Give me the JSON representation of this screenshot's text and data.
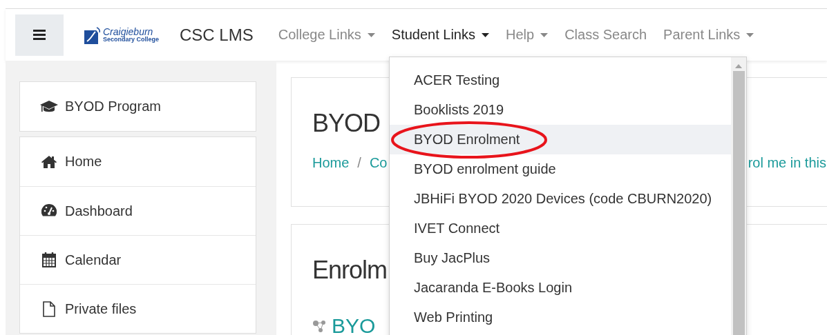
{
  "navbar": {
    "logo": {
      "name": "Craigieburn",
      "subtitle": "Secondary College"
    },
    "site_name": "CSC LMS",
    "links": [
      {
        "label": "College Links",
        "has_dropdown": true,
        "selected": false
      },
      {
        "label": "Student Links",
        "has_dropdown": true,
        "selected": true
      },
      {
        "label": "Help",
        "has_dropdown": true,
        "selected": false
      },
      {
        "label": "Class Search",
        "has_dropdown": false,
        "selected": false
      },
      {
        "label": "Parent Links",
        "has_dropdown": true,
        "selected": false
      }
    ]
  },
  "sidebar": {
    "groups": [
      [
        {
          "label": "BYOD Program",
          "kind": "course"
        }
      ],
      [
        {
          "label": "Home",
          "kind": "home"
        },
        {
          "label": "Dashboard",
          "kind": "dashboard"
        },
        {
          "label": "Calendar",
          "kind": "calendar"
        },
        {
          "label": "Private files",
          "kind": "files"
        }
      ]
    ]
  },
  "main": {
    "heading": "BYOD",
    "breadcrumb": [
      "Home",
      "/",
      "Co"
    ],
    "action_link": "rol me in this",
    "section_heading": "Enrolm",
    "course_link": "BYO"
  },
  "dropdown": {
    "items": [
      {
        "label": "ACER Testing",
        "highlighted": false,
        "circled": false
      },
      {
        "label": "Booklists 2019",
        "highlighted": false,
        "circled": false
      },
      {
        "label": "BYOD Enrolment",
        "highlighted": true,
        "circled": true
      },
      {
        "label": "BYOD enrolment guide",
        "highlighted": false,
        "circled": false
      },
      {
        "label": "JBHiFi BYOD 2020 Devices (code CBURN2020)",
        "highlighted": false,
        "circled": false
      },
      {
        "label": "IVET Connect",
        "highlighted": false,
        "circled": false
      },
      {
        "label": "Buy JacPlus",
        "highlighted": false,
        "circled": false
      },
      {
        "label": "Jacaranda E-Books Login",
        "highlighted": false,
        "circled": false
      },
      {
        "label": "Web Printing",
        "highlighted": false,
        "circled": false
      }
    ]
  }
}
